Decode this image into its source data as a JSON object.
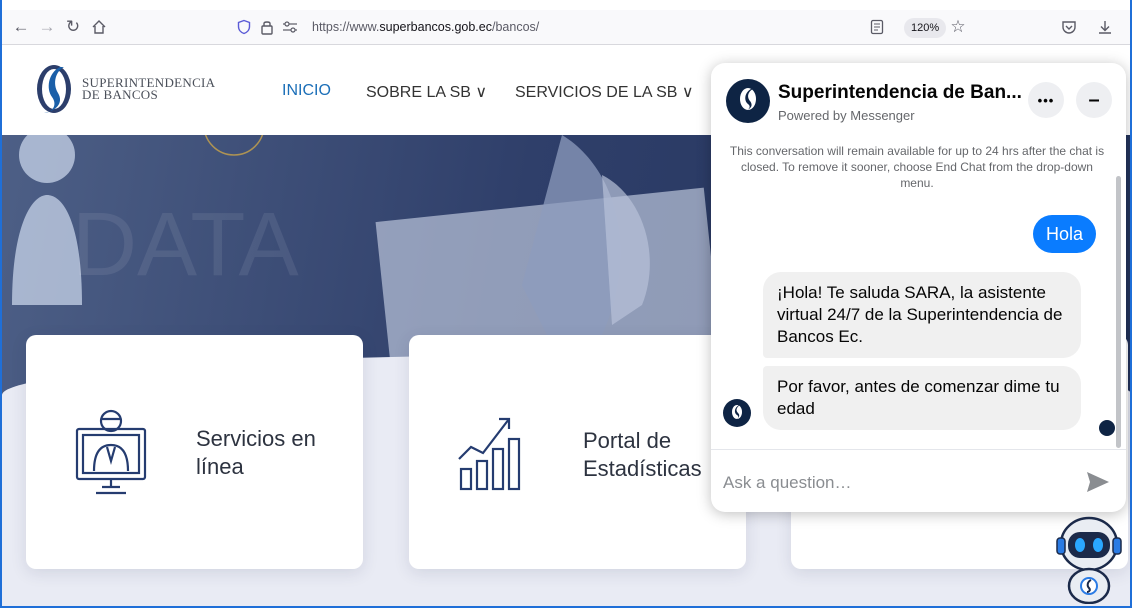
{
  "browser": {
    "url_prefix": "https://www.",
    "url_domain": "superbancos.gob.ec",
    "url_path": "/bancos/",
    "zoom": "120%"
  },
  "site": {
    "logo_line1": "SUPERINTENDENCIA",
    "logo_line2": "DE BANCOS",
    "nav": [
      {
        "label": "INICIO"
      },
      {
        "label": "SOBRE LA SB ∨"
      },
      {
        "label": "SERVICIOS DE LA SB ∨"
      }
    ],
    "cards": [
      {
        "line1": "Servicios en",
        "line2": "línea"
      },
      {
        "line1": "Portal de",
        "line2": "Estadísticas"
      }
    ]
  },
  "chat": {
    "title": "Superintendencia de Ban...",
    "subtitle": "Powered by Messenger",
    "notice": "This conversation will remain available for up to 24 hrs after the chat is closed. To remove it sooner, choose End Chat from the drop-down menu.",
    "messages": [
      {
        "from": "user",
        "text": "Hola"
      },
      {
        "from": "bot",
        "text": "¡Hola! Te saluda SARA, la asistente virtual 24/7 de la Superintendencia de Bancos Ec."
      },
      {
        "from": "bot",
        "text": "Por favor, antes de comenzar dime tu edad"
      }
    ],
    "input_placeholder": "Ask a question…",
    "more_label": "•••",
    "minimize_label": "–"
  },
  "colors": {
    "accent": "#1c6fb8",
    "messenger_blue": "#0a7cff"
  }
}
